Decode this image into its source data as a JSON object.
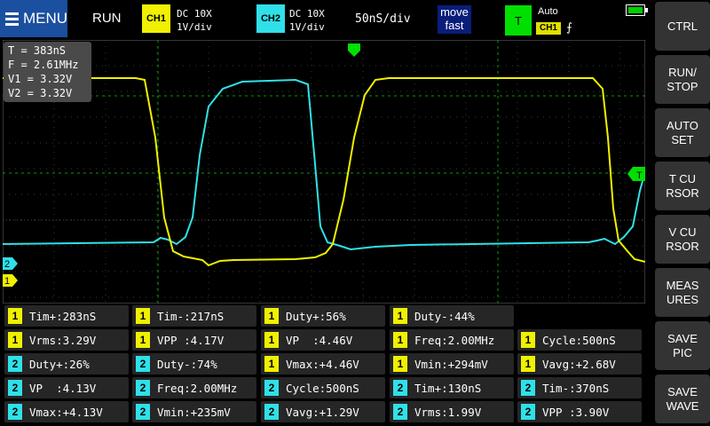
{
  "colors": {
    "ch1": "#f0f000",
    "ch2": "#30e0e8",
    "trigger": "#00e000",
    "menu": "#1b4fa0"
  },
  "top": {
    "menu_label": "MENU",
    "run_state": "RUN",
    "ch1": {
      "label": "CH1",
      "coupling": "DC 10X",
      "scale": "1V/div"
    },
    "ch2": {
      "label": "CH2",
      "coupling": "DC 10X",
      "scale": "1V/div"
    },
    "timebase": "50nS/div",
    "move": {
      "line1": "move",
      "line2": "fast"
    },
    "trigger": {
      "label": "T",
      "mode": "Auto",
      "source": "CH1",
      "edge": "⨍"
    }
  },
  "readout": {
    "t": "T = 383nS",
    "f": "F = 2.61MHz",
    "v1": "V1 = 3.32V",
    "v2": "V2 = 3.32V"
  },
  "markers": {
    "ch1": "1",
    "ch2": "2",
    "trigger": "T"
  },
  "side_buttons": [
    "CTRL",
    "RUN/\nSTOP",
    "AUTO\nSET",
    "T CU\nRSOR",
    "V CU\nRSOR",
    "MEAS\nURES",
    "SAVE\nPIC",
    "SAVE\nWAVE"
  ],
  "measurements": [
    [
      {
        "ch": "1",
        "text": "Tim+:283nS"
      },
      {
        "ch": "1",
        "text": "Tim-:217nS"
      },
      {
        "ch": "1",
        "text": "Duty+:56%"
      },
      {
        "ch": "1",
        "text": "Duty-:44%"
      }
    ],
    [
      {
        "ch": "1",
        "text": "Vrms:3.29V"
      },
      {
        "ch": "1",
        "text": "VPP :4.17V"
      },
      {
        "ch": "1",
        "text": "VP  :4.46V"
      },
      {
        "ch": "1",
        "text": "Freq:2.00MHz"
      },
      {
        "ch": "1",
        "text": "Cycle:500nS"
      }
    ],
    [
      {
        "ch": "2",
        "text": "Duty+:26%"
      },
      {
        "ch": "2",
        "text": "Duty-:74%"
      },
      {
        "ch": "1",
        "text": "Vmax:+4.46V"
      },
      {
        "ch": "1",
        "text": "Vmin:+294mV"
      },
      {
        "ch": "1",
        "text": "Vavg:+2.68V"
      }
    ],
    [
      {
        "ch": "2",
        "text": "VP  :4.13V"
      },
      {
        "ch": "2",
        "text": "Freq:2.00MHz"
      },
      {
        "ch": "2",
        "text": "Cycle:500nS"
      },
      {
        "ch": "2",
        "text": "Tim+:130nS"
      },
      {
        "ch": "2",
        "text": "Tim-:370nS"
      }
    ],
    [
      {
        "ch": "2",
        "text": "Vmax:+4.13V"
      },
      {
        "ch": "2",
        "text": "Vmin:+235mV"
      },
      {
        "ch": "2",
        "text": "Vavg:+1.29V"
      },
      {
        "ch": "2",
        "text": "Vrms:1.99V"
      },
      {
        "ch": "2",
        "text": "VPP :3.90V"
      }
    ]
  ]
}
